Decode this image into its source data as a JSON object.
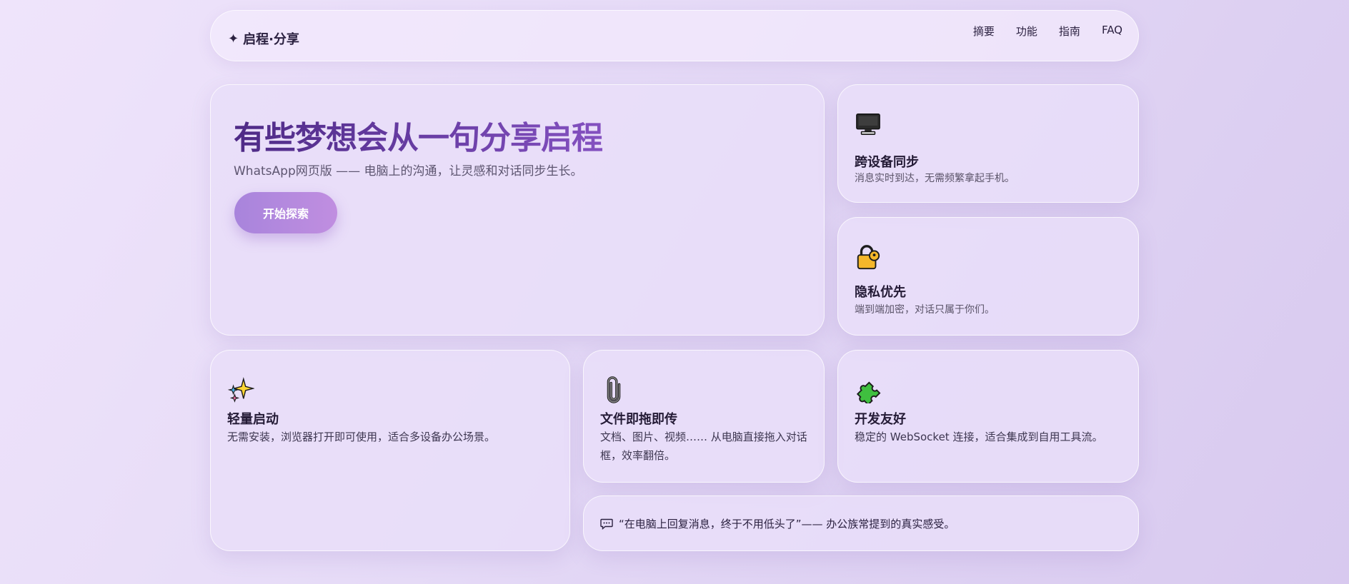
{
  "header": {
    "brand": "启程·分享",
    "brand_icon": "sparkle-icon",
    "nav": [
      "摘要",
      "功能",
      "指南",
      "FAQ"
    ]
  },
  "hero": {
    "title": "有些梦想会从一句分享启程",
    "subtitle": "WhatsApp网页版 —— 电脑上的沟通，让灵感和对话同步生长。",
    "cta": "开始探索"
  },
  "features": {
    "sync": {
      "icon": "monitor-icon",
      "title": "跨设备同步",
      "desc": "消息实时到达，无需频繁拿起手机。"
    },
    "privacy": {
      "icon": "lock-icon",
      "title": "隐私优先",
      "desc": "端到端加密，对话只属于你们。"
    },
    "light": {
      "icon": "sparkles-icon",
      "title": "轻量启动",
      "desc": "无需安装，浏览器打开即可使用，适合多设备办公场景。"
    },
    "drag": {
      "icon": "paperclip-icon",
      "title": "文件即拖即传",
      "desc": "文档、图片、视频…… 从电脑直接拖入对话框，效率翻倍。"
    },
    "dev": {
      "icon": "puzzle-icon",
      "title": "开发友好",
      "desc": "稳定的 WebSocket 连接，适合集成到自用工具流。"
    }
  },
  "quote": {
    "icon": "speech-bubble-icon",
    "text": "“在电脑上回复消息，终于不用低头了”—— 办公族常提到的真实感受。"
  },
  "colors": {
    "accent_start": "#a884dc",
    "accent_end": "#c08ee0",
    "title_gradient_start": "#4e2a86",
    "title_gradient_end": "#8451c0"
  }
}
